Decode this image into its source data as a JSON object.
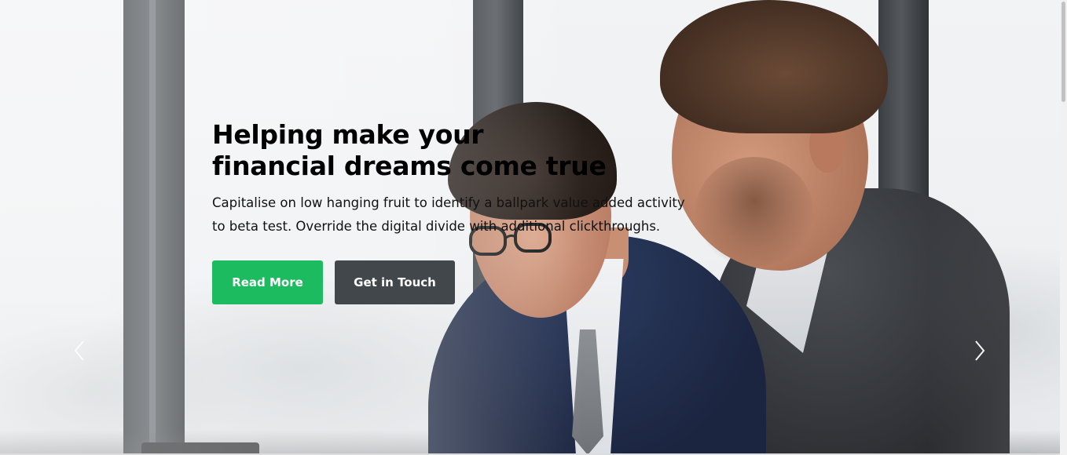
{
  "hero": {
    "title_lines": [
      "Helping make your",
      "financial dreams come true"
    ],
    "text_lines": [
      "Capitalise on low hanging fruit to identify a ballpark value added activity",
      "to beta test. Override the digital divide with additional clickthroughs."
    ],
    "buttons": {
      "read_more": "Read More",
      "get_in_touch": "Get in Touch"
    },
    "colors": {
      "primary_button": "#1cbb5f",
      "secondary_button": "#42474c",
      "title": "#000000"
    }
  },
  "carousel": {
    "prev_icon": "chevron-left-icon",
    "next_icon": "chevron-right-icon"
  },
  "background": {
    "subject": "two businessmen looking at a laptop in an office"
  }
}
